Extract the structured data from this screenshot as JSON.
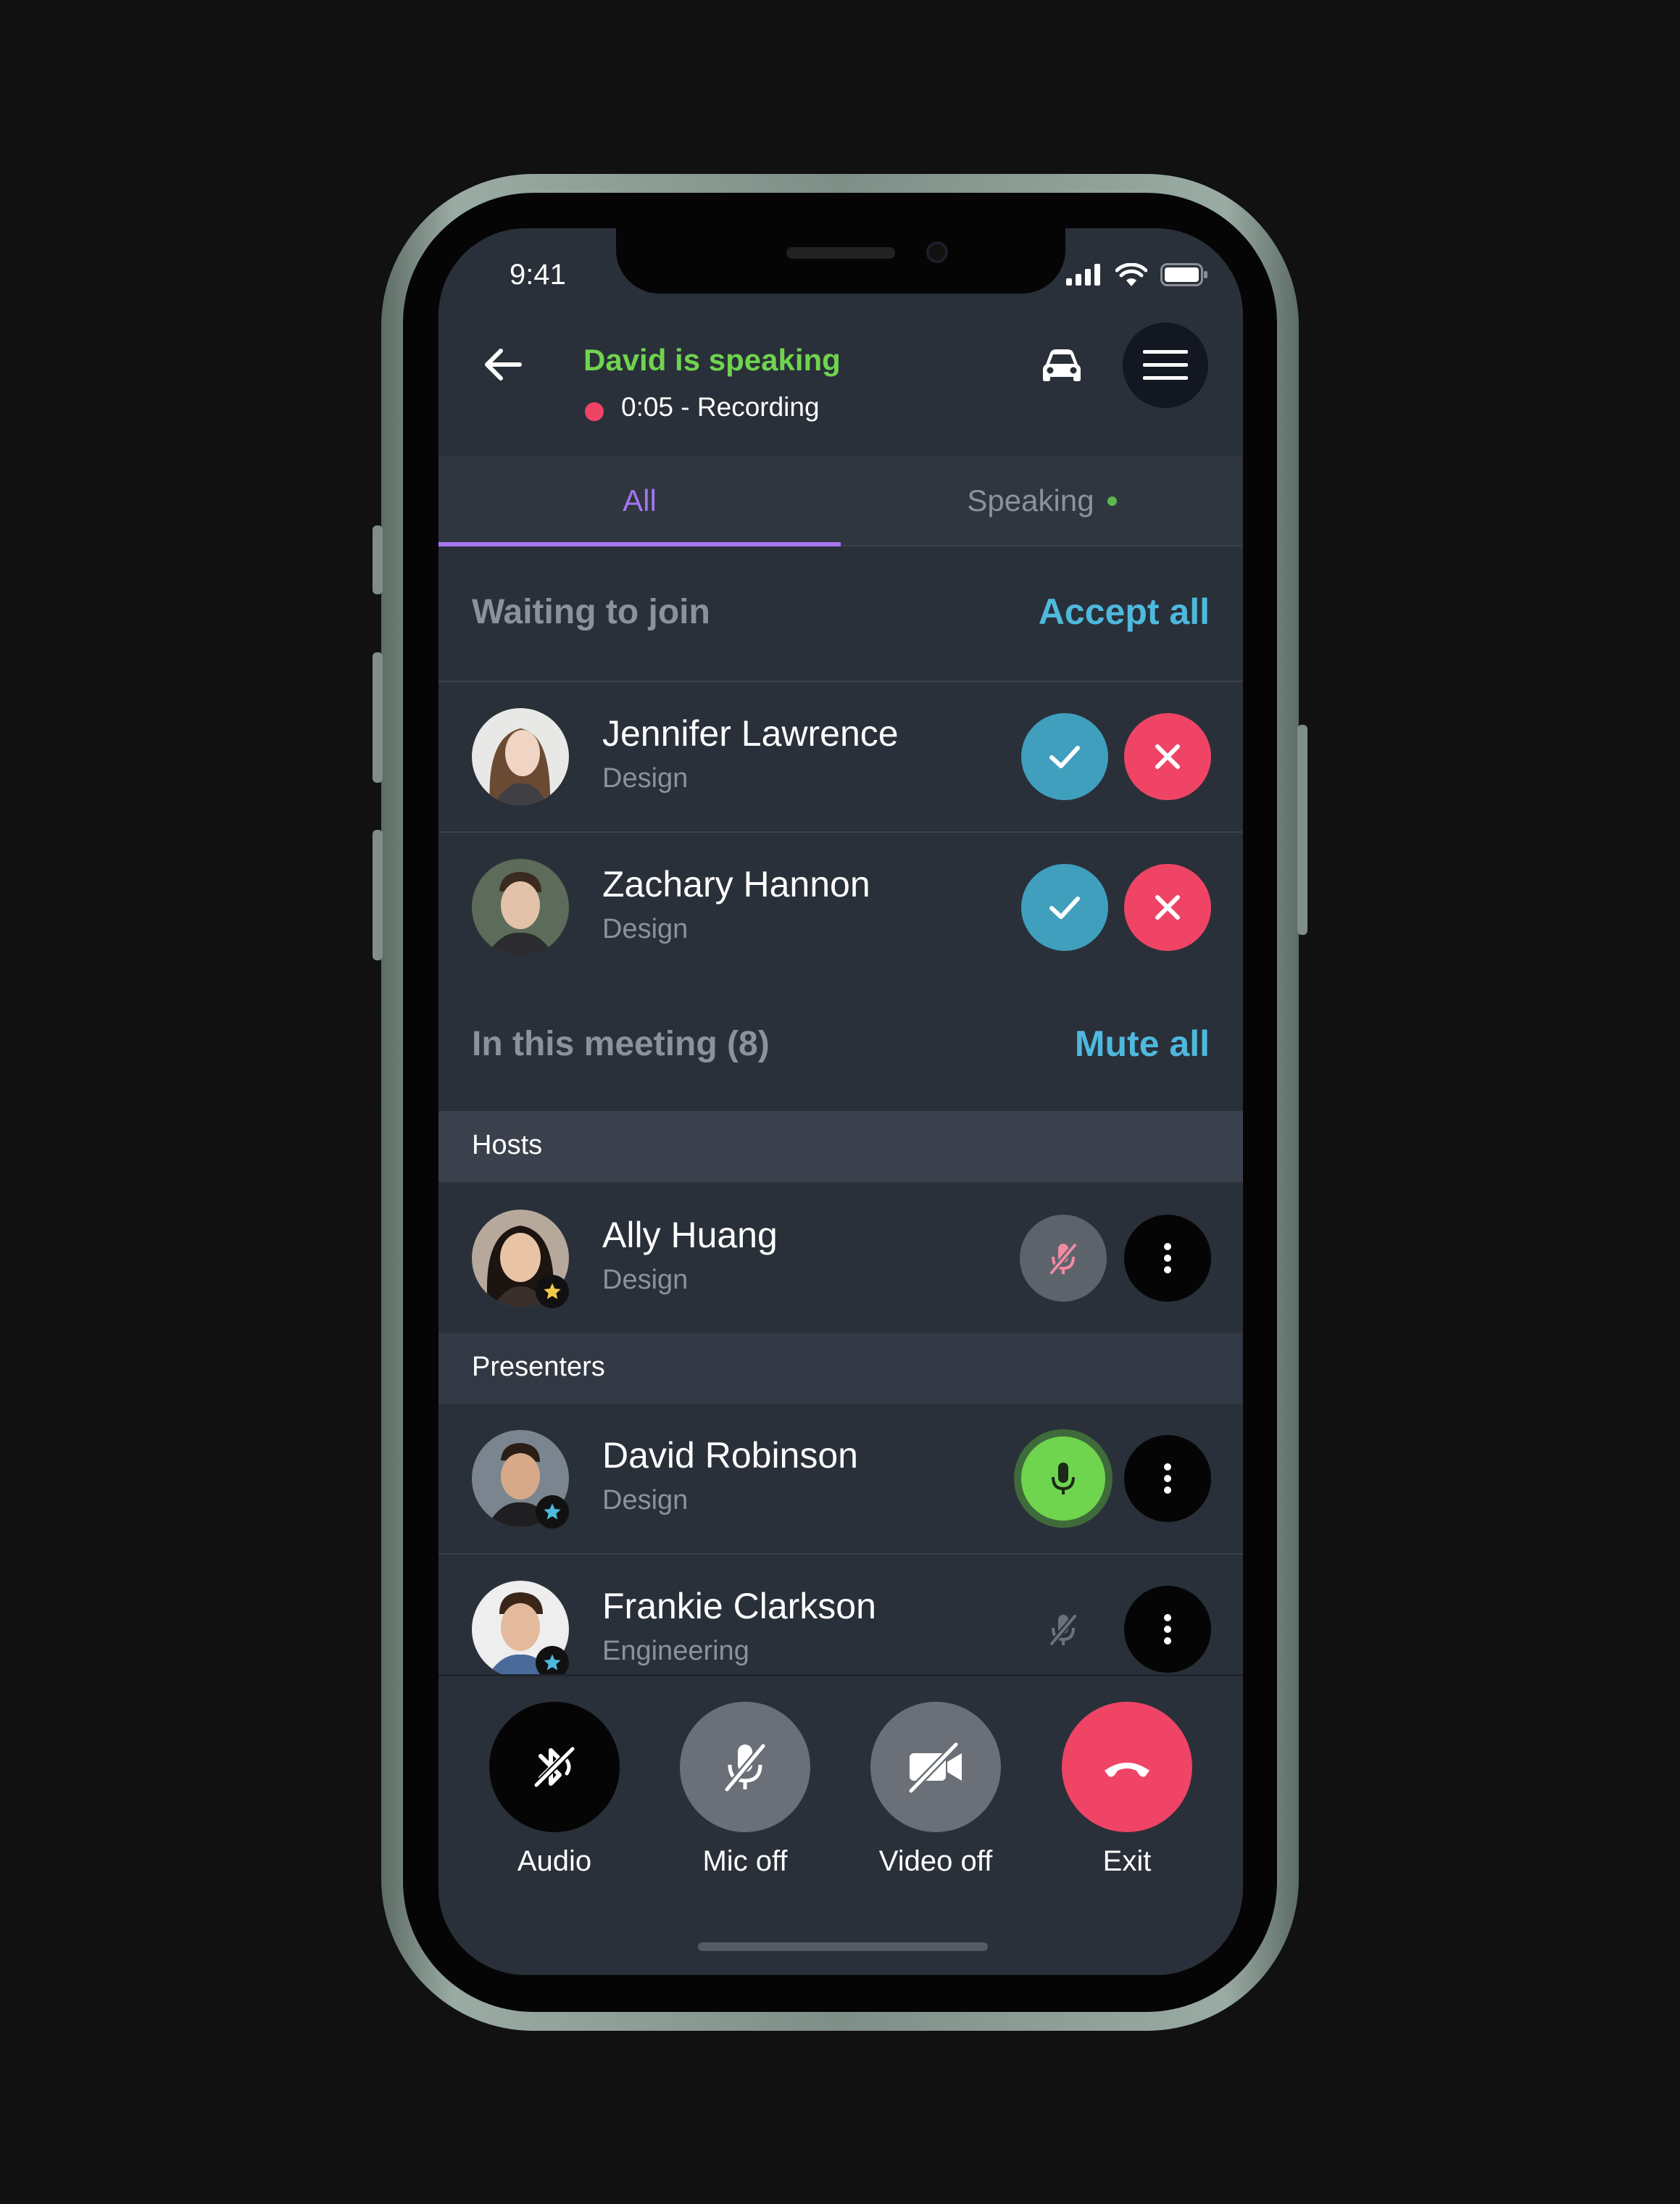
{
  "status_bar": {
    "time": "9:41"
  },
  "header": {
    "back_icon": "arrow-left-icon",
    "speaking_text": "David is speaking",
    "recording_text": "0:05 - Recording",
    "car_icon": "car-icon",
    "menu_icon": "hamburger-menu-icon"
  },
  "tabs": [
    {
      "label": "All",
      "active": true
    },
    {
      "label": "Speaking",
      "active": false
    }
  ],
  "waiting": {
    "title": "Waiting to join",
    "action": "Accept all",
    "people": [
      {
        "name": "Jennifer Lawrence",
        "role": "Design"
      },
      {
        "name": "Zachary Hannon",
        "role": "Design"
      }
    ]
  },
  "meeting": {
    "title": "In this meeting (8)",
    "action": "Mute all",
    "hosts_label": "Hosts",
    "presenters_label": "Presenters",
    "hosts": [
      {
        "name": "Ally Huang",
        "role": "Design",
        "mic": "muted"
      }
    ],
    "presenters": [
      {
        "name": "David Robinson",
        "role": "Design",
        "mic": "speaking"
      },
      {
        "name": "Frankie Clarkson",
        "role": "Engineering",
        "mic": "muted"
      }
    ]
  },
  "controls": [
    {
      "label": "Audio",
      "icon": "bluetooth-audio-icon"
    },
    {
      "label": "Mic off",
      "icon": "mic-off-icon"
    },
    {
      "label": "Video off",
      "icon": "video-off-icon"
    },
    {
      "label": "Exit",
      "icon": "hang-up-icon"
    }
  ],
  "colors": {
    "background": "#2a3039",
    "accent_purple": "#a675ef",
    "accent_blue": "#4eb9dd",
    "speaking_green": "#6fd44e",
    "danger_red": "#ef4466",
    "accept_blue": "#3f9fbd"
  }
}
